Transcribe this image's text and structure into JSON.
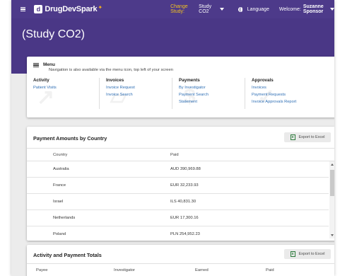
{
  "nav": {
    "brand": "DrugDevSpark",
    "brand_mark": "d",
    "change_study_label": "Change Study:",
    "current_study": "Study CO2",
    "language_label": "Language",
    "welcome_label": "Welcome:",
    "user_name": "Suzanne Sponsor"
  },
  "page_title": "(Study CO2)",
  "menu": {
    "title": "Menu",
    "subtitle": "Navigation is also available via the menu icon, top left of your screen",
    "columns": [
      {
        "heading": "Activity",
        "links": [
          "Patient Visits"
        ]
      },
      {
        "heading": "Invoices",
        "links": [
          "Invoice Request",
          "Invoice Search"
        ]
      },
      {
        "heading": "Payments",
        "links": [
          "By Investigator",
          "Payment Search",
          "Statement"
        ]
      },
      {
        "heading": "Approvals",
        "links": [
          "Invoices",
          "Payment Requests",
          "Invoice Approvals Report"
        ]
      }
    ]
  },
  "payment_amounts": {
    "title": "Payment Amounts by Country",
    "export_label": "Export to Excel",
    "columns": [
      "Country",
      "Paid"
    ],
    "rows": [
      {
        "country": "Australia",
        "paid": "AUD  390,969.88"
      },
      {
        "country": "France",
        "paid": "EUR  32,233.93"
      },
      {
        "country": "Israel",
        "paid": "ILS  40,831.30"
      },
      {
        "country": "Netherlands",
        "paid": "EUR  17,300.16"
      },
      {
        "country": "Poland",
        "paid": "PLN  254,952.23"
      }
    ]
  },
  "activity_totals": {
    "title": "Activity and Payment Totals",
    "export_label": "Export to Excel",
    "columns": [
      "Payee",
      "Investigator",
      "Earned",
      "Paid"
    ]
  },
  "colors": {
    "nav_bg": "#4d3a8a",
    "accent": "#f3c21e",
    "link": "#2f6fb5"
  }
}
